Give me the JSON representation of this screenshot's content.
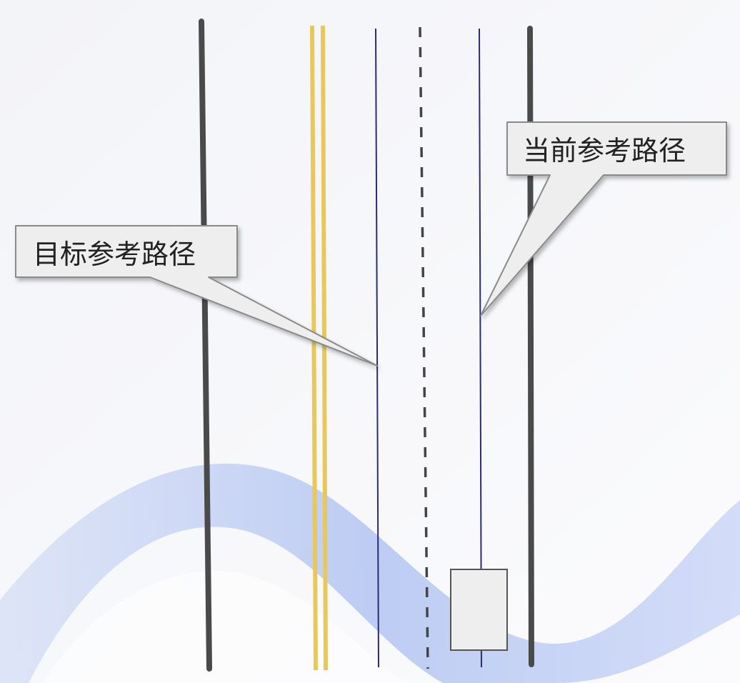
{
  "callouts": {
    "target_path": "目标参考路径",
    "current_path": "当前参考路径"
  },
  "colors": {
    "road_edge": "#4a4a4a",
    "center_double_yellow": "#e8c85a",
    "reference_path": "#2a2a7a",
    "lane_divider_dashed": "#444444",
    "vehicle_fill": "#eeeeee",
    "callout_fill": "#eeeeee",
    "background_wave": "#b9c8f2"
  }
}
